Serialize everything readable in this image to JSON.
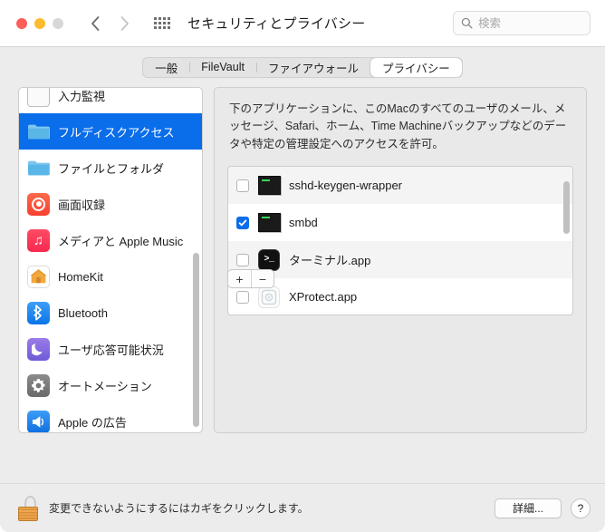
{
  "window": {
    "title": "セキュリティとプライバシー",
    "traffic_lights": [
      "close",
      "minimize",
      "maximize"
    ],
    "colors": {
      "close": "#fc5f57",
      "minimize": "#fdbc2e",
      "maximize": "#d8d8d8",
      "accent": "#0a6dea",
      "titlebar_bg": "#ffffff",
      "window_bg": "#ececec",
      "panel_bg": "#e9e9e9"
    }
  },
  "nav": {
    "back_icon": "chevron-left-icon",
    "forward_icon": "chevron-right-icon",
    "grid_icon": "show-all-grid-icon"
  },
  "search": {
    "icon": "search-icon",
    "placeholder": "検索",
    "value": ""
  },
  "tabs": [
    {
      "label": "一般",
      "selected": false
    },
    {
      "label": "FileVault",
      "selected": false
    },
    {
      "label": "ファイアウォール",
      "selected": false
    },
    {
      "label": "プライバシー",
      "selected": true
    }
  ],
  "sidebar": {
    "items": [
      {
        "label": "入力監視",
        "icon": "keyboard-icon",
        "selected": false
      },
      {
        "label": "フルディスクアクセス",
        "icon": "folder-icon",
        "selected": true
      },
      {
        "label": "ファイルとフォルダ",
        "icon": "folder-icon",
        "selected": false
      },
      {
        "label": "画面収録",
        "icon": "screen-recording-icon",
        "selected": false
      },
      {
        "label": "メディアと Apple Music",
        "icon": "music-note-icon",
        "selected": false
      },
      {
        "label": "HomeKit",
        "icon": "homekit-house-icon",
        "selected": false
      },
      {
        "label": "Bluetooth",
        "icon": "bluetooth-icon",
        "selected": false
      },
      {
        "label": "ユーザ応答可能状況",
        "icon": "moon-focus-icon",
        "selected": false
      },
      {
        "label": "オートメーション",
        "icon": "gear-icon",
        "selected": false
      },
      {
        "label": "Apple の広告",
        "icon": "megaphone-ads-icon",
        "selected": false
      }
    ],
    "scrollbar": {
      "visible": true,
      "thumb_top_pct": 48,
      "thumb_height_pct": 50
    }
  },
  "panel": {
    "description": "下のアプリケーションに、このMacのすべてのユーザのメール、メッセージ、Safari、ホーム、Time Machineバックアップなどのデータや特定の管理設定へのアクセスを許可。",
    "apps": [
      {
        "name": "sshd-keygen-wrapper",
        "checked": false,
        "icon": "unix-executable-icon"
      },
      {
        "name": "smbd",
        "checked": true,
        "icon": "unix-executable-icon"
      },
      {
        "name": "ターミナル.app",
        "checked": false,
        "icon": "terminal-app-icon"
      },
      {
        "name": "XProtect.app",
        "checked": false,
        "icon": "xprotect-app-icon"
      }
    ],
    "scrollbar": {
      "visible": true,
      "thumb_top_pct": 10,
      "thumb_height_pct": 36
    },
    "add_button_label": "+",
    "remove_button_label": "−"
  },
  "bottom": {
    "lock_icon": "unlocked-padlock-icon",
    "lock_state": "unlocked",
    "message": "変更できないようにするにはカギをクリックします。",
    "advanced_label": "詳細...",
    "help_label": "?"
  }
}
